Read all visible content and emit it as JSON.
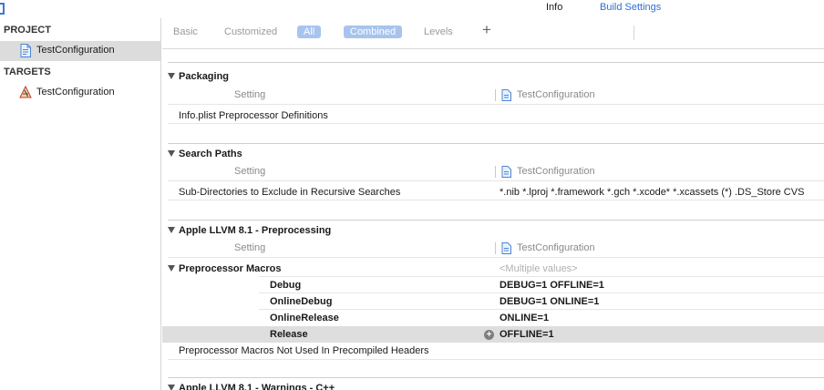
{
  "top_tabs": {
    "info": "Info",
    "build_settings": "Build Settings"
  },
  "sidebar": {
    "project_header": "PROJECT",
    "project_items": [
      {
        "label": "TestConfiguration"
      }
    ],
    "targets_header": "TARGETS",
    "target_items": [
      {
        "label": "TestConfiguration"
      }
    ]
  },
  "filters": {
    "basic": "Basic",
    "customized": "Customized",
    "all": "All",
    "combined": "Combined",
    "levels": "Levels",
    "add": "+"
  },
  "sections": [
    {
      "title": "Packaging",
      "col_setting": "Setting",
      "col_target": "TestConfiguration",
      "rows": [
        {
          "name": "Info.plist Preprocessor Definitions",
          "value": ""
        }
      ]
    },
    {
      "title": "Search Paths",
      "col_setting": "Setting",
      "col_target": "TestConfiguration",
      "rows": [
        {
          "name": "Sub-Directories to Exclude in Recursive Searches",
          "value": "*.nib *.lproj *.framework *.gch *.xcode* *.xcassets (*) .DS_Store CVS"
        }
      ]
    },
    {
      "title": "Apple LLVM 8.1 - Preprocessing",
      "col_setting": "Setting",
      "col_target": "TestConfiguration",
      "macros": {
        "name": "Preprocessor Macros",
        "value": "<Multiple values>",
        "configs": [
          {
            "name": "Debug",
            "value": "DEBUG=1  OFFLINE=1"
          },
          {
            "name": "OnlineDebug",
            "value": "DEBUG=1  ONLINE=1"
          },
          {
            "name": "OnlineRelease",
            "value": "ONLINE=1"
          },
          {
            "name": "Release",
            "value": "OFFLINE=1"
          }
        ]
      },
      "rows_after": [
        {
          "name": "Preprocessor Macros Not Used In Precompiled Headers",
          "value": ""
        }
      ]
    },
    {
      "title": "Apple LLVM 8.1 - Warnings - C++"
    }
  ],
  "colors": {
    "accent": "#2f6fd6",
    "pill": "#a8c4ee",
    "selected_row": "#dcdcdc"
  }
}
